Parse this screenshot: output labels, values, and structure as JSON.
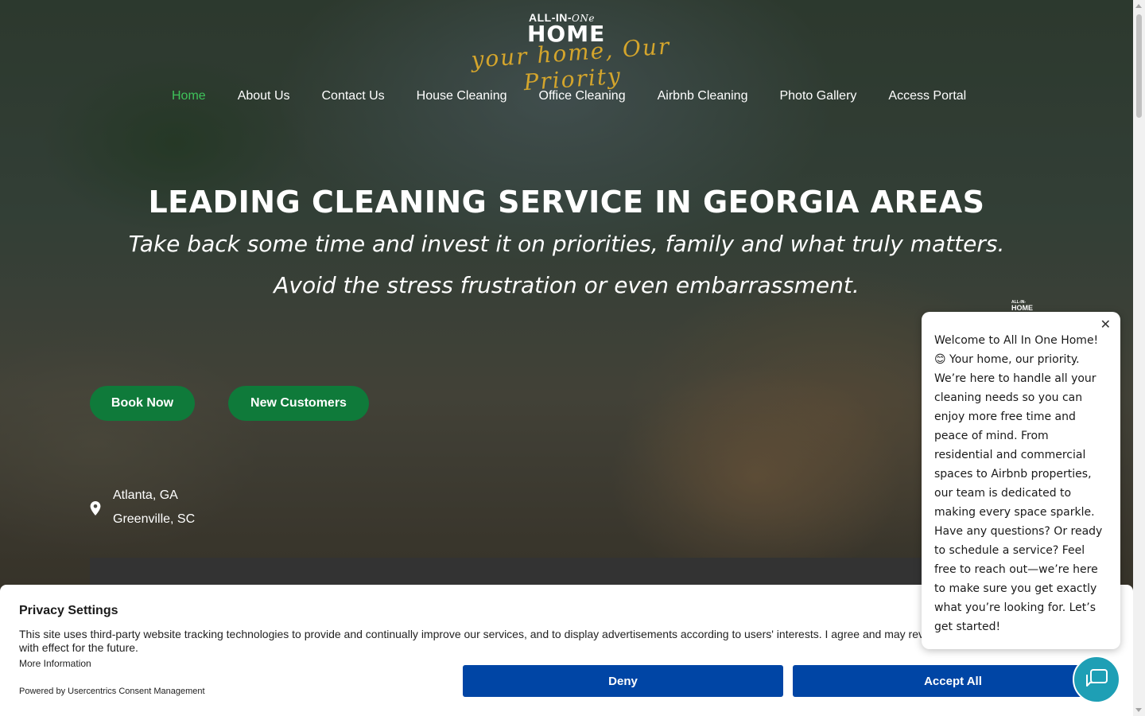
{
  "logo": {
    "top_text": "ALL-IN-",
    "top_text_script": "ONe",
    "main_text": "HOME",
    "tagline": "your home, Our Priority"
  },
  "nav": {
    "items": [
      {
        "label": "Home",
        "active": true
      },
      {
        "label": "About Us",
        "active": false
      },
      {
        "label": "Contact Us",
        "active": false
      },
      {
        "label": "House Cleaning",
        "active": false
      },
      {
        "label": "Office Cleaning",
        "active": false
      },
      {
        "label": "Airbnb Cleaning",
        "active": false
      },
      {
        "label": "Photo Gallery",
        "active": false
      },
      {
        "label": "Access Portal",
        "active": false
      }
    ]
  },
  "hero": {
    "headline": "LEADING CLEANING SERVICE IN GEORGIA AREAS",
    "subline1": "Take back some time and invest it on priorities, family and what truly matters.",
    "subline2": "Avoid the stress frustration or even embarrassment.",
    "book_label": "Book Now",
    "new_customers_label": "New Customers",
    "locations": [
      "Atlanta, GA",
      "Greenville, SC"
    ]
  },
  "mini_logo": {
    "line1": "ALL-IN-",
    "line2": "HOME"
  },
  "consent": {
    "title": "Privacy Settings",
    "description": "This site uses third-party website tracking technologies to provide and continually improve our services, and to display advertisements according to users' interests. I agree and may rev with effect for the future.",
    "more_info": "More Information",
    "powered_by": "Powered by Usercentrics Consent Management",
    "deny_label": "Deny",
    "accept_label": "Accept All"
  },
  "chat": {
    "message": "Welcome to All In One Home! 😊 Your home, our priority. We’re here to handle all your cleaning needs so you can enjoy more free time and peace of mind. From residential and commercial spaces to Airbnb properties, our team is dedicated to making every space sparkle. Have any questions? Or ready to schedule a service? Feel free to reach out—we’re here to make sure you get exactly what you’re looking for. Let’s get started!",
    "close_glyph": "✕"
  },
  "colors": {
    "nav_active": "#3fc35a",
    "button_green": "#0f7a3a",
    "consent_button": "#0045a5",
    "chat_button": "#1e9fb5",
    "tagline_gold": "#d4a52c"
  }
}
